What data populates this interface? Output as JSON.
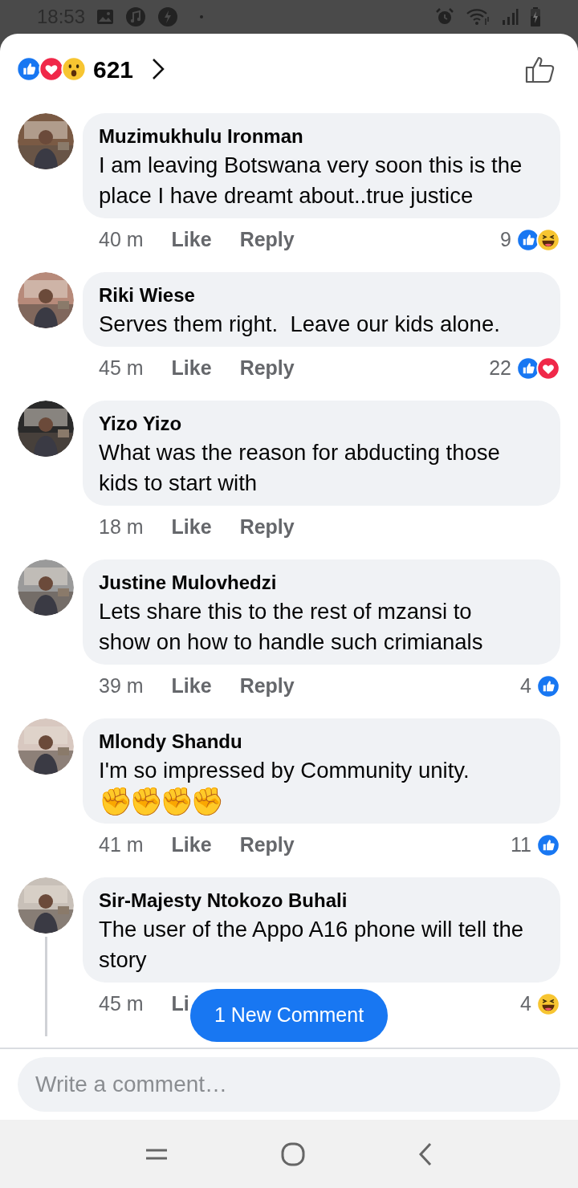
{
  "status_bar": {
    "time": "18:53"
  },
  "header": {
    "reaction_count": "621",
    "reactions": [
      {
        "kind": "like"
      },
      {
        "kind": "love"
      },
      {
        "kind": "wow"
      }
    ]
  },
  "comments": [
    {
      "author": "Muzimukhulu Ironman",
      "text": "I am leaving Botswana very soon this is the place I have dreamt about..true justice",
      "time": "40 m",
      "like": "Like",
      "reply": "Reply",
      "reaction_count": "9",
      "reactions": [
        {
          "kind": "like"
        },
        {
          "kind": "haha"
        }
      ],
      "has_replies": false
    },
    {
      "author": "Riki Wiese",
      "text": "Serves them right.  Leave our kids alone.",
      "time": "45 m",
      "like": "Like",
      "reply": "Reply",
      "reaction_count": "22",
      "reactions": [
        {
          "kind": "like"
        },
        {
          "kind": "love"
        }
      ],
      "has_replies": false
    },
    {
      "author": "Yizo Yizo",
      "text": "What was the reason for abducting those kids to start with",
      "time": "18 m",
      "like": "Like",
      "reply": "Reply",
      "has_replies": false
    },
    {
      "author": "Justine Mulovhedzi",
      "text": "Lets share this to the rest of mzansi to show on how to handle such crimianals",
      "time": "39 m",
      "like": "Like",
      "reply": "Reply",
      "reaction_count": "4",
      "reactions": [
        {
          "kind": "like"
        }
      ],
      "has_replies": false
    },
    {
      "author": "Mlondy Shandu",
      "text": "I'm so impressed by Community unity.",
      "emoji": "✊✊✊✊",
      "time": "41 m",
      "like": "Like",
      "reply": "Reply",
      "reaction_count": "11",
      "reactions": [
        {
          "kind": "like"
        }
      ],
      "has_replies": false
    },
    {
      "author": "Sir-Majesty Ntokozo Buhali",
      "text": "The user of the Appo A16 phone will tell the story",
      "time": "45 m",
      "like": "Li",
      "reaction_count": "4",
      "reactions": [
        {
          "kind": "haha"
        }
      ],
      "has_replies": true
    }
  ],
  "new_comments_button": "1 New Comment",
  "composer": {
    "placeholder": "Write a comment…"
  }
}
